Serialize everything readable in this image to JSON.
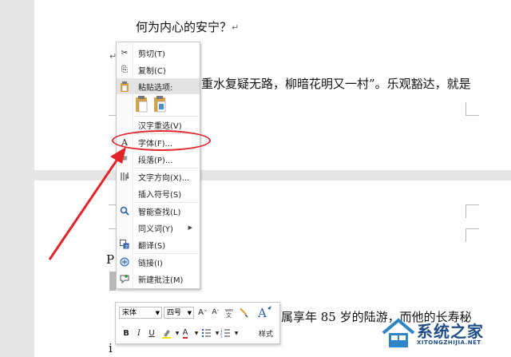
{
  "document": {
    "heading_line": "何为内心的安宁？",
    "line_2": "重水复疑无路，柳暗花明又一村”。乐观豁达，就是",
    "line_3_partial": "属享年 85 岁的陆游，而他的长寿秘",
    "line_left_fragment": "P",
    "line_bottom_fragment": "i"
  },
  "context_menu": {
    "items": [
      {
        "icon": "scissors-icon",
        "label": "剪切(T)"
      },
      {
        "icon": "copy-icon",
        "label": "复制(C)"
      },
      {
        "icon": "clipboard-icon",
        "label": "粘贴选项:"
      },
      {
        "icon": "",
        "label": "汉字重选(V)"
      },
      {
        "icon": "font-icon",
        "label": "字体(F)..."
      },
      {
        "icon": "paragraph-icon",
        "label": "段落(P)..."
      },
      {
        "icon": "text-direction-icon",
        "label": "文字方向(X)..."
      },
      {
        "icon": "",
        "label": "插入符号(S)"
      },
      {
        "icon": "smart-lookup-icon",
        "label": "智能查找(L)"
      },
      {
        "icon": "",
        "label": "同义词(Y)"
      },
      {
        "icon": "translate-icon",
        "label": "翻译(S)"
      },
      {
        "icon": "link-icon",
        "label": "链接(I)"
      },
      {
        "icon": "new-comment-icon",
        "label": "新建批注(M)"
      }
    ]
  },
  "mini_toolbar": {
    "font_name": "宋体",
    "font_size": "四号",
    "styles_label": "样式",
    "grow_font": "A",
    "shrink_font": "A",
    "bold": "B",
    "italic": "I",
    "underline": "U",
    "font_color_letter": "A"
  },
  "watermark": {
    "title": "系统之家",
    "subtitle": "XITONGZHIJIA.NET"
  },
  "colors": {
    "annotation_red": "#e1252a",
    "watermark_blue": "#1f4d86"
  }
}
